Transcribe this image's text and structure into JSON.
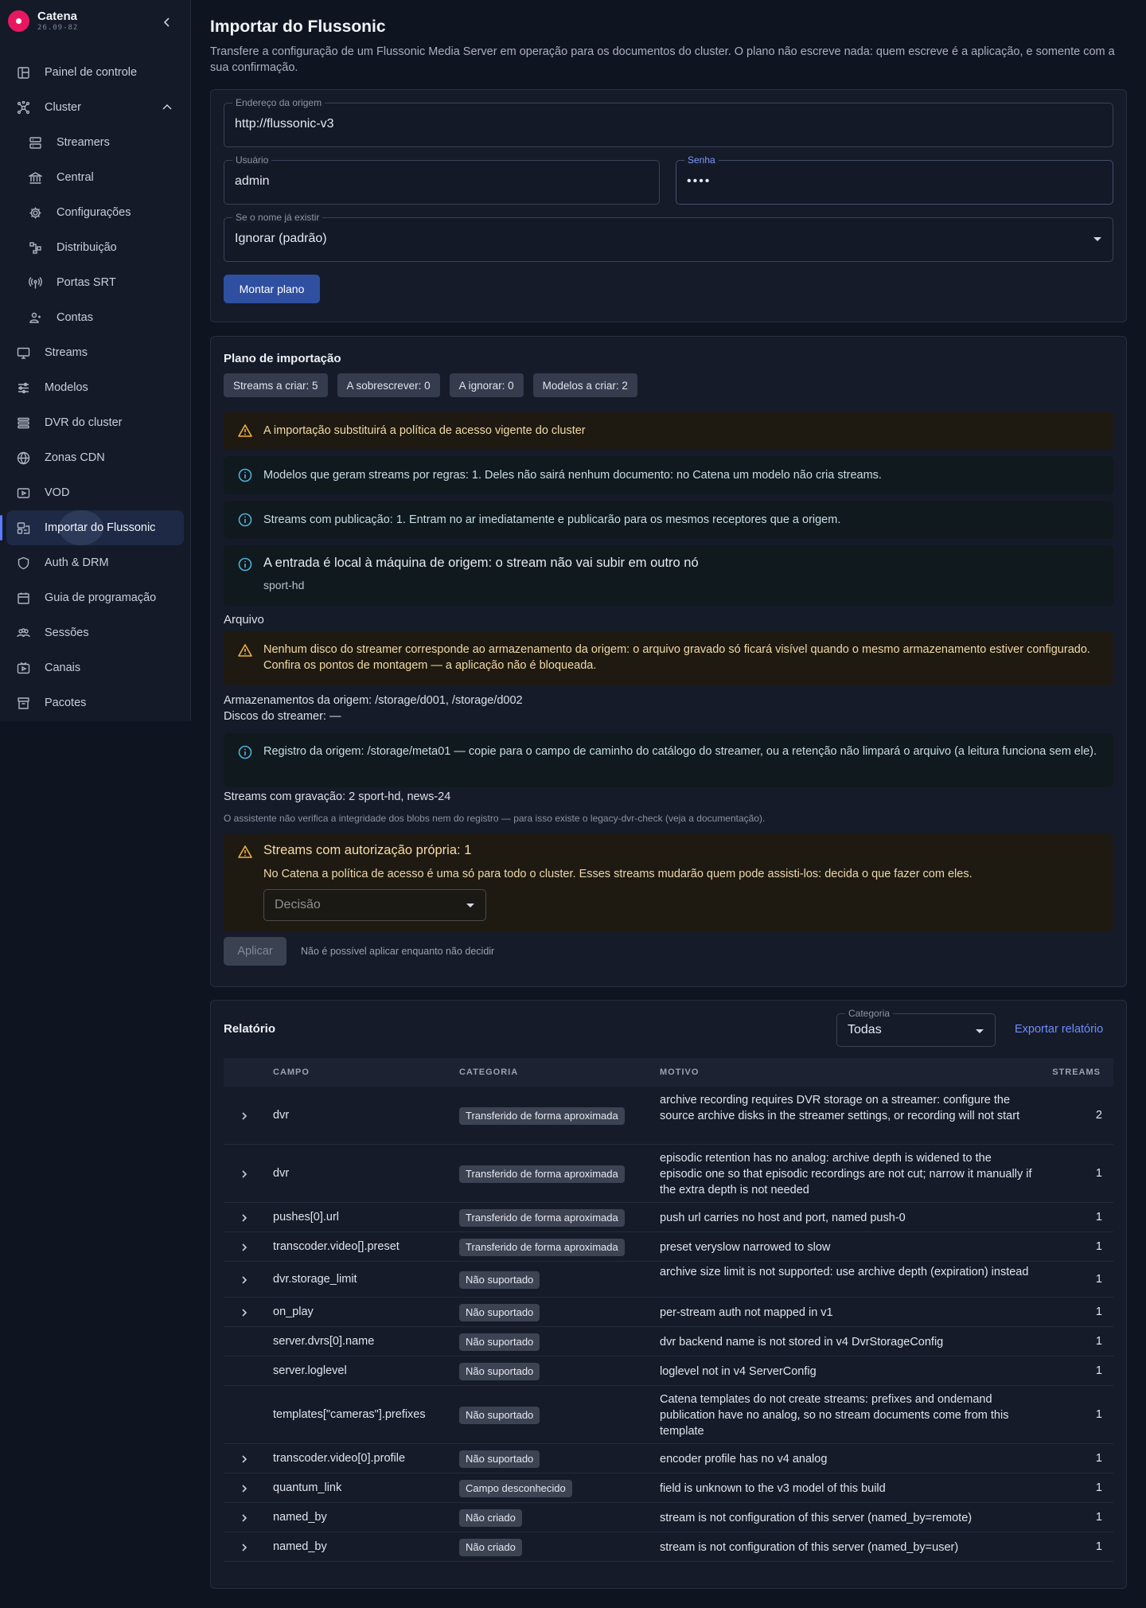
{
  "app": {
    "name": "Catena",
    "version": "26.09-82"
  },
  "sidebar": {
    "items": [
      {
        "label": "Painel de controle",
        "icon": "dashboard-icon",
        "sub": false
      },
      {
        "label": "Cluster",
        "icon": "cluster-icon",
        "sub": false,
        "expanded": true
      },
      {
        "label": "Streamers",
        "icon": "server-icon",
        "sub": true
      },
      {
        "label": "Central",
        "icon": "bank-icon",
        "sub": true
      },
      {
        "label": "Configurações",
        "icon": "gear-icon",
        "sub": true
      },
      {
        "label": "Distribuição",
        "icon": "distribution-icon",
        "sub": true
      },
      {
        "label": "Portas SRT",
        "icon": "antenna-icon",
        "sub": true
      },
      {
        "label": "Contas",
        "icon": "accounts-icon",
        "sub": true
      },
      {
        "label": "Streams",
        "icon": "monitor-icon",
        "sub": false
      },
      {
        "label": "Modelos",
        "icon": "sliders-icon",
        "sub": false
      },
      {
        "label": "DVR do cluster",
        "icon": "list-icon",
        "sub": false
      },
      {
        "label": "Zonas CDN",
        "icon": "globe-icon",
        "sub": false
      },
      {
        "label": "VOD",
        "icon": "vod-icon",
        "sub": false
      },
      {
        "label": "Importar do Flussonic",
        "icon": "import-icon",
        "sub": false,
        "active": true
      },
      {
        "label": "Auth & DRM",
        "icon": "shield-icon",
        "sub": false
      },
      {
        "label": "Guia de programação",
        "icon": "calendar-icon",
        "sub": false
      },
      {
        "label": "Sessões",
        "icon": "users-icon",
        "sub": false
      },
      {
        "label": "Canais",
        "icon": "channels-icon",
        "sub": false
      },
      {
        "label": "Pacotes",
        "icon": "package-icon",
        "sub": false
      }
    ]
  },
  "page": {
    "title": "Importar do Flussonic",
    "description": "Transfere a configuração de um Flussonic Media Server em operação para os documentos do cluster. O plano não escreve nada: quem escreve é a aplicação, e somente com a sua confirmação."
  },
  "form": {
    "source": {
      "label": "Endereço da origem",
      "value": "http://flussonic-v3"
    },
    "user": {
      "label": "Usuário",
      "value": "admin"
    },
    "password": {
      "label": "Senha",
      "value": "••••"
    },
    "conflict": {
      "label": "Se o nome já existir",
      "value": "Ignorar (padrão)"
    },
    "build_button": "Montar plano"
  },
  "plan": {
    "title": "Plano de importação",
    "chips": [
      "Streams a criar: 5",
      "A sobrescrever: 0",
      "A ignorar: 0",
      "Modelos a criar: 2"
    ],
    "alert_policy": "A importação substituirá a política de acesso vigente do cluster",
    "alert_models": "Modelos que geram streams por regras: 1. Deles não sairá nenhum documento: no Catena um modelo não cria streams.",
    "alert_publish": "Streams com publicação: 1. Entram no ar imediatamente e publicarão para os mesmos receptores que a origem.",
    "alert_local_title": "A entrada é local à máquina de origem: o stream não vai subir em outro nó",
    "alert_local_sub": "sport-hd",
    "archive_title": "Arquivo",
    "archive_warn": "Nenhum disco do streamer corresponde ao armazenamento da origem: o arquivo gravado só ficará visível quando o mesmo armazenamento estiver configurado. Confira os pontos de montagem — a aplicação não é bloqueada.",
    "storages_line": "Armazenamentos da origem: /storage/d001, /storage/d002",
    "disks_line": "Discos do streamer: —",
    "registry_info": "Registro da origem: /storage/meta01 — copie para o campo de caminho do catálogo do streamer, ou a retenção não limpará o arquivo (a leitura funciona sem ele).",
    "recording_line": "Streams com gravação: 2 sport-hd, news-24",
    "integrity_note": "O assistente não verifica a integridade dos blobs nem do registro — para isso existe o legacy-dvr-check (veja a documentação).",
    "auth_title": "Streams com autorização própria: 1",
    "auth_text": "No Catena a política de acesso é uma só para todo o cluster. Esses streams mudarão quem pode assisti-los: decida o que fazer com eles.",
    "decision_placeholder": "Decisão",
    "apply_button": "Aplicar",
    "apply_note": "Não é possível aplicar enquanto não decidir"
  },
  "report": {
    "title": "Relatório",
    "category": {
      "label": "Categoria",
      "value": "Todas"
    },
    "export": "Exportar relatório",
    "columns": {
      "field": "CAMPO",
      "category": "CATEGORIA",
      "reason": "MOTIVO",
      "streams": "STREAMS"
    },
    "rows": [
      {
        "exp": true,
        "field": "dvr",
        "category": "Transferido de forma aproximada",
        "reason": "archive recording requires DVR storage on a streamer: configure the source archive disks in the streamer settings, or recording will not start",
        "streams": "2"
      },
      {
        "exp": true,
        "field": "dvr",
        "category": "Transferido de forma aproximada",
        "reason": "episodic retention has no analog: archive depth is widened to the episodic one so that episodic recordings are not cut; narrow it manually if the extra depth is not needed",
        "streams": "1"
      },
      {
        "exp": true,
        "field": "pushes[0].url",
        "category": "Transferido de forma aproximada",
        "reason": "push url carries no host and port, named push-0",
        "streams": "1"
      },
      {
        "exp": true,
        "field": "transcoder.video[].preset",
        "category": "Transferido de forma aproximada",
        "reason": "preset veryslow narrowed to slow",
        "streams": "1"
      },
      {
        "exp": true,
        "field": "dvr.storage_limit",
        "category": "Não suportado",
        "reason": "archive size limit is not supported: use archive depth (expiration) instead",
        "streams": "1"
      },
      {
        "exp": true,
        "field": "on_play",
        "category": "Não suportado",
        "reason": "per-stream auth not mapped in v1",
        "streams": "1"
      },
      {
        "exp": false,
        "field": "server.dvrs[0].name",
        "category": "Não suportado",
        "reason": "dvr backend name is not stored in v4 DvrStorageConfig",
        "streams": "1"
      },
      {
        "exp": false,
        "field": "server.loglevel",
        "category": "Não suportado",
        "reason": "loglevel not in v4 ServerConfig",
        "streams": "1"
      },
      {
        "exp": false,
        "field": "templates[\"cameras\"].prefixes",
        "category": "Não suportado",
        "reason": "Catena templates do not create streams: prefixes and ondemand publication have no analog, so no stream documents come from this template",
        "streams": "1"
      },
      {
        "exp": true,
        "field": "transcoder.video[0].profile",
        "category": "Não suportado",
        "reason": "encoder profile has no v4 analog",
        "streams": "1"
      },
      {
        "exp": true,
        "field": "quantum_link",
        "category": "Campo desconhecido",
        "reason": "field is unknown to the v3 model of this build",
        "streams": "1"
      },
      {
        "exp": true,
        "field": "named_by",
        "category": "Não criado",
        "reason": "stream is not configuration of this server (named_by=remote)",
        "streams": "1"
      },
      {
        "exp": true,
        "field": "named_by",
        "category": "Não criado",
        "reason": "stream is not configuration of this server (named_by=user)",
        "streams": "1"
      }
    ]
  },
  "colors": {
    "accent": "#2f4fa0",
    "link": "#6f8cff",
    "brand": "#e8185f",
    "warn": "#f0b040",
    "info": "#4fb0dc"
  }
}
